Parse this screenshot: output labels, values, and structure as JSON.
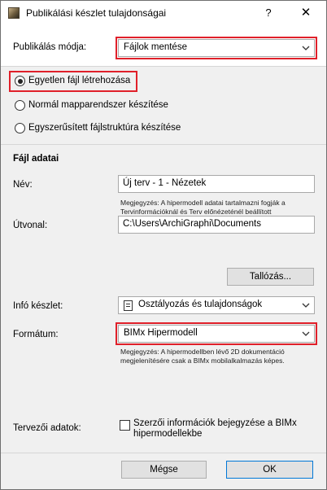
{
  "window": {
    "title": "Publikálási készlet tulajdonságai",
    "help_glyph": "?",
    "close_glyph": "✕",
    "icon": "archicad-app-icon"
  },
  "publish_mode": {
    "label": "Publikálás módja:",
    "value": "Fájlok mentése"
  },
  "options": {
    "single_file": "Egyetlen fájl létrehozása",
    "normal_folder": "Normál mapparendszer készítése",
    "simplified": "Egyszerűsített fájlstruktúra készítése",
    "selected": "single_file"
  },
  "file_data": {
    "heading": "Fájl adatai",
    "name_label": "Név:",
    "name_value": "Új terv - 1 - Nézetek",
    "name_note": "Megjegyzés: A hipermodell adatai tartalmazni fogják a Tervinformációknál és Terv előnézeténél beállított információkat.",
    "path_label": "Útvonal:",
    "path_value": "C:\\Users\\ArchiGraphi\\Documents",
    "browse_button": "Tallózás...",
    "info_label": "Infó készlet:",
    "info_value": "Osztályozás és tulajdonságok",
    "format_label": "Formátum:",
    "format_value": "BIMx Hipermodell",
    "format_note": "Megjegyzés: A hipermodellben lévő 2D dokumentáció megjelenítésére csak a BIMx mobilalkalmazás képes.",
    "designer_label": "Tervezői adatok:",
    "designer_checkbox": "Szerzői információk bejegyzése a BIMx hipermodellekbe"
  },
  "footer": {
    "cancel": "Mégse",
    "ok": "OK"
  },
  "colors": {
    "highlight": "#e0202a",
    "primary_border": "#0078d7"
  }
}
